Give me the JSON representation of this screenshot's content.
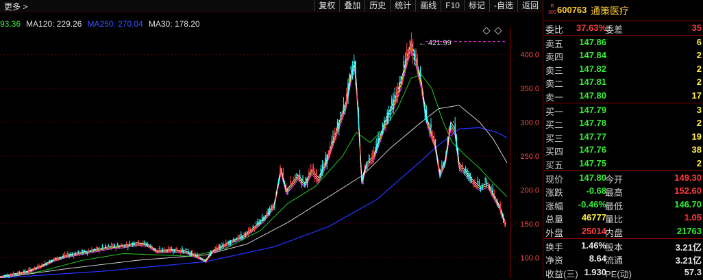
{
  "toolbar": {
    "more": "更多 >",
    "buttons": [
      "复权",
      "叠加",
      "历史",
      "统计",
      "画线",
      "F10",
      "标记",
      "-自选",
      "返回"
    ]
  },
  "ma": [
    {
      "label": "93.36",
      "color": "#33ee33"
    },
    {
      "label": "MA120: 229.26",
      "color": "#e0e0e0"
    },
    {
      "label": "MA250: 270.04",
      "color": "#3355ff"
    },
    {
      "label": "MA30: 178.20",
      "color": "#e0e0e0"
    }
  ],
  "chart_data": {
    "type": "line",
    "description_series": [
      "price",
      "MA30",
      "MA120",
      "MA250"
    ],
    "ylim": [
      70,
      440
    ],
    "yticks": [
      100.0,
      150.0,
      200.0,
      250.0,
      300.0,
      350.0,
      400.0
    ],
    "ytick_labels": [
      "100.0",
      "150.0",
      "200.0",
      "250.0",
      "300.0",
      "350.0",
      "400.0"
    ],
    "peak_label": "421.99",
    "colors": {
      "price_up": "#ff4444",
      "price_down": "#33ffff",
      "ma_a": "#ffffff",
      "ma_b": "#ffee44",
      "ma_c": "#ff44ff",
      "ma30": "#22cc22",
      "ma120": "#d0d0d0",
      "ma250": "#2233ff"
    },
    "price_points": [
      [
        0,
        72
      ],
      [
        20,
        76
      ],
      [
        40,
        80
      ],
      [
        60,
        88
      ],
      [
        80,
        98
      ],
      [
        100,
        104
      ],
      [
        120,
        108
      ],
      [
        140,
        112
      ],
      [
        160,
        116
      ],
      [
        180,
        118
      ],
      [
        200,
        122
      ],
      [
        215,
        120
      ],
      [
        230,
        110
      ],
      [
        250,
        112
      ],
      [
        270,
        110
      ],
      [
        285,
        104
      ],
      [
        300,
        96
      ],
      [
        310,
        110
      ],
      [
        325,
        118
      ],
      [
        340,
        126
      ],
      [
        355,
        132
      ],
      [
        370,
        144
      ],
      [
        385,
        158
      ],
      [
        400,
        178
      ],
      [
        410,
        232
      ],
      [
        418,
        200
      ],
      [
        425,
        208
      ],
      [
        435,
        222
      ],
      [
        445,
        210
      ],
      [
        455,
        230
      ],
      [
        465,
        218
      ],
      [
        475,
        240
      ],
      [
        485,
        270
      ],
      [
        495,
        300
      ],
      [
        505,
        330
      ],
      [
        512,
        370
      ],
      [
        518,
        390
      ],
      [
        522,
        330
      ],
      [
        528,
        215
      ],
      [
        535,
        240
      ],
      [
        545,
        250
      ],
      [
        555,
        280
      ],
      [
        565,
        310
      ],
      [
        575,
        330
      ],
      [
        585,
        360
      ],
      [
        595,
        400
      ],
      [
        600,
        418
      ],
      [
        607,
        395
      ],
      [
        615,
        360
      ],
      [
        622,
        310
      ],
      [
        628,
        290
      ],
      [
        635,
        270
      ],
      [
        642,
        225
      ],
      [
        650,
        245
      ],
      [
        658,
        300
      ],
      [
        664,
        290
      ],
      [
        670,
        240
      ],
      [
        678,
        230
      ],
      [
        690,
        215
      ],
      [
        700,
        205
      ],
      [
        712,
        210
      ],
      [
        722,
        190
      ],
      [
        730,
        175
      ],
      [
        738,
        150
      ]
    ],
    "ma30_points": [
      [
        0,
        70
      ],
      [
        60,
        80
      ],
      [
        120,
        96
      ],
      [
        180,
        106
      ],
      [
        230,
        104
      ],
      [
        280,
        102
      ],
      [
        330,
        114
      ],
      [
        380,
        140
      ],
      [
        420,
        180
      ],
      [
        460,
        205
      ],
      [
        500,
        250
      ],
      [
        520,
        285
      ],
      [
        540,
        270
      ],
      [
        560,
        290
      ],
      [
        580,
        320
      ],
      [
        600,
        365
      ],
      [
        615,
        370
      ],
      [
        630,
        350
      ],
      [
        645,
        305
      ],
      [
        660,
        270
      ],
      [
        680,
        250
      ],
      [
        700,
        232
      ],
      [
        720,
        210
      ],
      [
        740,
        190
      ]
    ],
    "ma120_points": [
      [
        0,
        70
      ],
      [
        100,
        84
      ],
      [
        200,
        96
      ],
      [
        300,
        104
      ],
      [
        360,
        120
      ],
      [
        420,
        152
      ],
      [
        480,
        190
      ],
      [
        530,
        222
      ],
      [
        570,
        262
      ],
      [
        610,
        296
      ],
      [
        640,
        320
      ],
      [
        670,
        325
      ],
      [
        700,
        300
      ],
      [
        720,
        275
      ],
      [
        740,
        240
      ]
    ],
    "ma250_points": [
      [
        0,
        70
      ],
      [
        150,
        80
      ],
      [
        300,
        94
      ],
      [
        400,
        116
      ],
      [
        480,
        146
      ],
      [
        550,
        186
      ],
      [
        600,
        230
      ],
      [
        640,
        266
      ],
      [
        670,
        290
      ],
      [
        700,
        292
      ],
      [
        725,
        285
      ],
      [
        740,
        277
      ]
    ]
  },
  "quote": {
    "badge": "R\n300",
    "code": "600763",
    "name": "通策医疗",
    "weibi_label": "委比",
    "weibi_value": "37.63%",
    "weicha_label": "委差",
    "weicha_value": "35",
    "sells": [
      {
        "label": "卖五",
        "price": "147.86",
        "vol": "6"
      },
      {
        "label": "卖四",
        "price": "147.84",
        "vol": "2"
      },
      {
        "label": "卖三",
        "price": "147.82",
        "vol": "2"
      },
      {
        "label": "卖二",
        "price": "147.81",
        "vol": "2"
      },
      {
        "label": "卖一",
        "price": "147.80",
        "vol": "17"
      }
    ],
    "buys": [
      {
        "label": "买一",
        "price": "147.79",
        "vol": "3"
      },
      {
        "label": "买二",
        "price": "147.78",
        "vol": "2"
      },
      {
        "label": "买三",
        "price": "147.77",
        "vol": "19"
      },
      {
        "label": "买四",
        "price": "147.76",
        "vol": "38"
      },
      {
        "label": "买五",
        "price": "147.75",
        "vol": "2"
      }
    ],
    "stats": [
      {
        "l1": "现价",
        "v1": "147.80",
        "c1": "green",
        "l2": "今开",
        "v2": "149.30",
        "c2": "red"
      },
      {
        "l1": "涨跌",
        "v1": "-0.68",
        "c1": "green",
        "l2": "最高",
        "v2": "152.60",
        "c2": "red"
      },
      {
        "l1": "涨幅",
        "v1": "-0.46%",
        "c1": "green",
        "l2": "最低",
        "v2": "146.70",
        "c2": "green"
      },
      {
        "l1": "总量",
        "v1": "46777",
        "c1": "yellow",
        "l2": "量比",
        "v2": "1.05",
        "c2": "red"
      },
      {
        "l1": "外盘",
        "v1": "25014",
        "c1": "red",
        "l2": "内盘",
        "v2": "21763",
        "c2": "green"
      }
    ],
    "stats2": [
      {
        "l1": "换手",
        "v1": "1.46%",
        "l2": "股本",
        "v2": "3.21亿"
      },
      {
        "l1": "净资",
        "v1": "8.64",
        "l2": "流通",
        "v2": "3.21亿"
      },
      {
        "l1": "收益(三)",
        "v1": "1.930",
        "l2": "PE(动)",
        "v2": "57.3"
      }
    ]
  }
}
